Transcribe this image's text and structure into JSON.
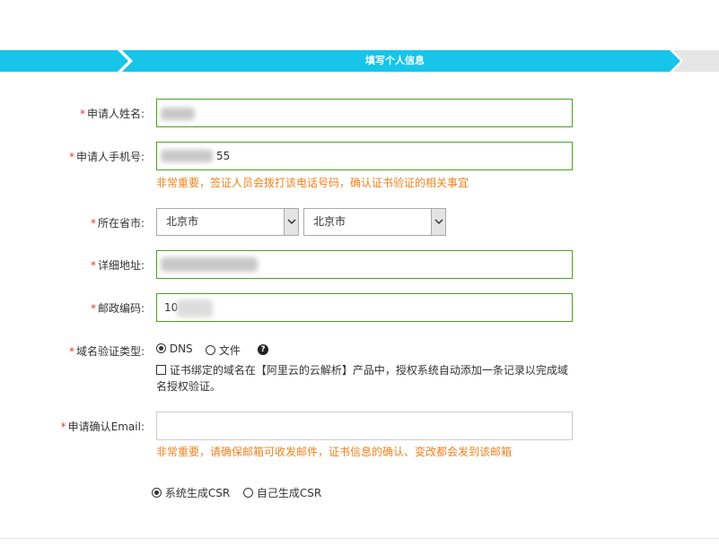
{
  "stepbar": {
    "title": "填写个人信息",
    "colors": {
      "active": "#16c5e9",
      "inactive": "#e6e6e6"
    }
  },
  "form": {
    "name": {
      "label": "申请人姓名:"
    },
    "phone": {
      "label": "申请人手机号:",
      "value_suffix": "55",
      "hint": "非常重要，签证人员会拨打该电话号码，确认证书验证的相关事宜"
    },
    "region": {
      "label": "所在省市:",
      "province": "北京市",
      "city": "北京市"
    },
    "address": {
      "label": "详细地址:"
    },
    "postcode": {
      "label": "邮政编码:",
      "value_prefix": "10"
    },
    "domain_verify": {
      "label": "域名验证类型:",
      "options": [
        "DNS",
        "文件"
      ],
      "selected": "DNS",
      "help_icon": "?",
      "checkbox_text_line1": "证书绑定的域名在【阿里云的云解析】产品中，授权系统自动添加一条记录以完成域",
      "checkbox_text_line2": "名授权验证。"
    },
    "email": {
      "label": "申请确认Email:",
      "value": "",
      "hint": "非常重要，请确保邮箱可收发邮件，证书信息的确认、变改都会发到该邮箱"
    },
    "csr": {
      "options": [
        "系统生成CSR",
        "自己生成CSR"
      ],
      "selected": "系统生成CSR"
    }
  },
  "required_mark": "*"
}
